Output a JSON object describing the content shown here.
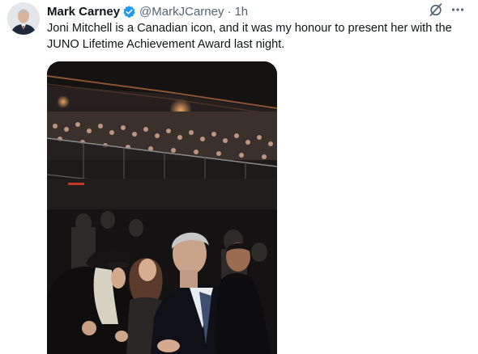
{
  "tweet": {
    "author": {
      "name": "Mark Carney",
      "handle": "@MarkJCarney",
      "separator": "·",
      "time": "1h"
    },
    "text": "Joni Mitchell is a Canadian icon, and it was my honour to present her with the JUNO Lifetime Achievement Award last night.",
    "icons": {
      "verified": "verified-badge-icon",
      "grok": "grok-icon",
      "more": "more-icon"
    },
    "colors": {
      "verified_blue": "#1d9bf0",
      "secondary_text": "#536471",
      "primary_text": "#0f1419"
    }
  }
}
